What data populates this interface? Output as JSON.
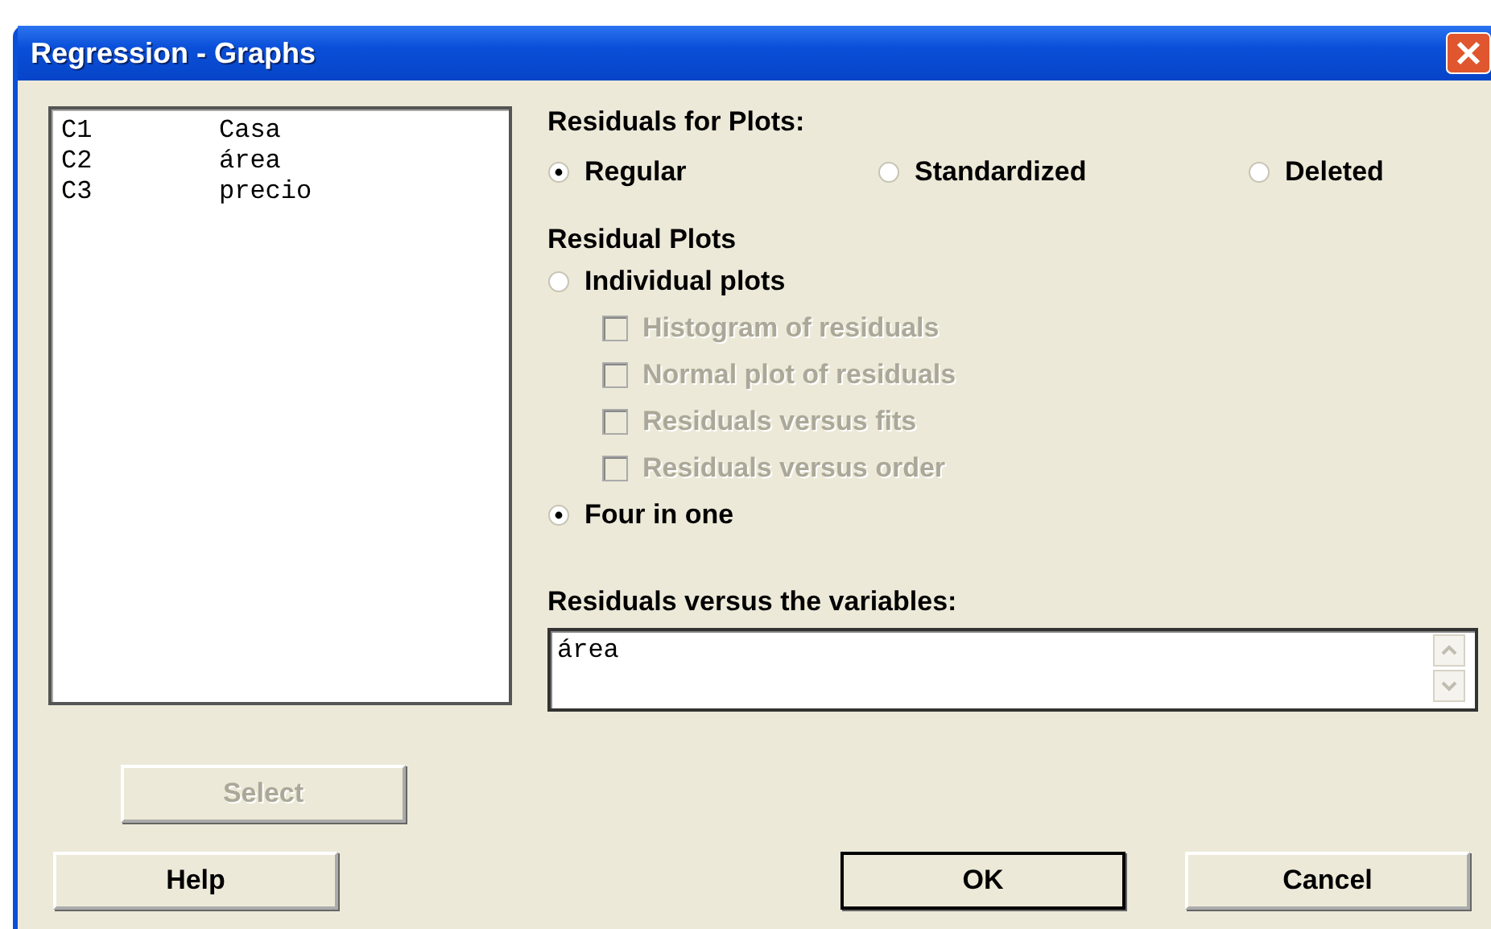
{
  "window": {
    "title": "Regression - Graphs"
  },
  "variables": [
    {
      "column": "C1",
      "name": "Casa"
    },
    {
      "column": "C2",
      "name": "área"
    },
    {
      "column": "C3",
      "name": "precio"
    }
  ],
  "residuals_for_plots": {
    "label": "Residuals for Plots:",
    "options": [
      {
        "label": "Regular",
        "selected": true
      },
      {
        "label": "Standardized",
        "selected": false
      },
      {
        "label": "Deleted",
        "selected": false
      }
    ]
  },
  "residual_plots": {
    "label": "Residual Plots",
    "options": [
      {
        "kind": "radio",
        "label": "Individual plots",
        "selected": false
      },
      {
        "kind": "checkbox",
        "label": "Histogram of residuals",
        "checked": false,
        "disabled": true
      },
      {
        "kind": "checkbox",
        "label": "Normal plot of residuals",
        "checked": false,
        "disabled": true
      },
      {
        "kind": "checkbox",
        "label": "Residuals versus fits",
        "checked": false,
        "disabled": true
      },
      {
        "kind": "checkbox",
        "label": "Residuals versus order",
        "checked": false,
        "disabled": true
      },
      {
        "kind": "radio",
        "label": "Four in one",
        "selected": true
      }
    ]
  },
  "variables_field": {
    "label": "Residuals versus the variables:",
    "value": "área"
  },
  "buttons": [
    {
      "kind": "select",
      "label": "Select",
      "disabled": true,
      "default": false
    },
    {
      "kind": "help",
      "label": "Help",
      "disabled": false,
      "default": false
    },
    {
      "kind": "ok",
      "label": "OK",
      "disabled": false,
      "default": true
    },
    {
      "kind": "cancel",
      "label": "Cancel",
      "disabled": false,
      "default": false
    }
  ]
}
